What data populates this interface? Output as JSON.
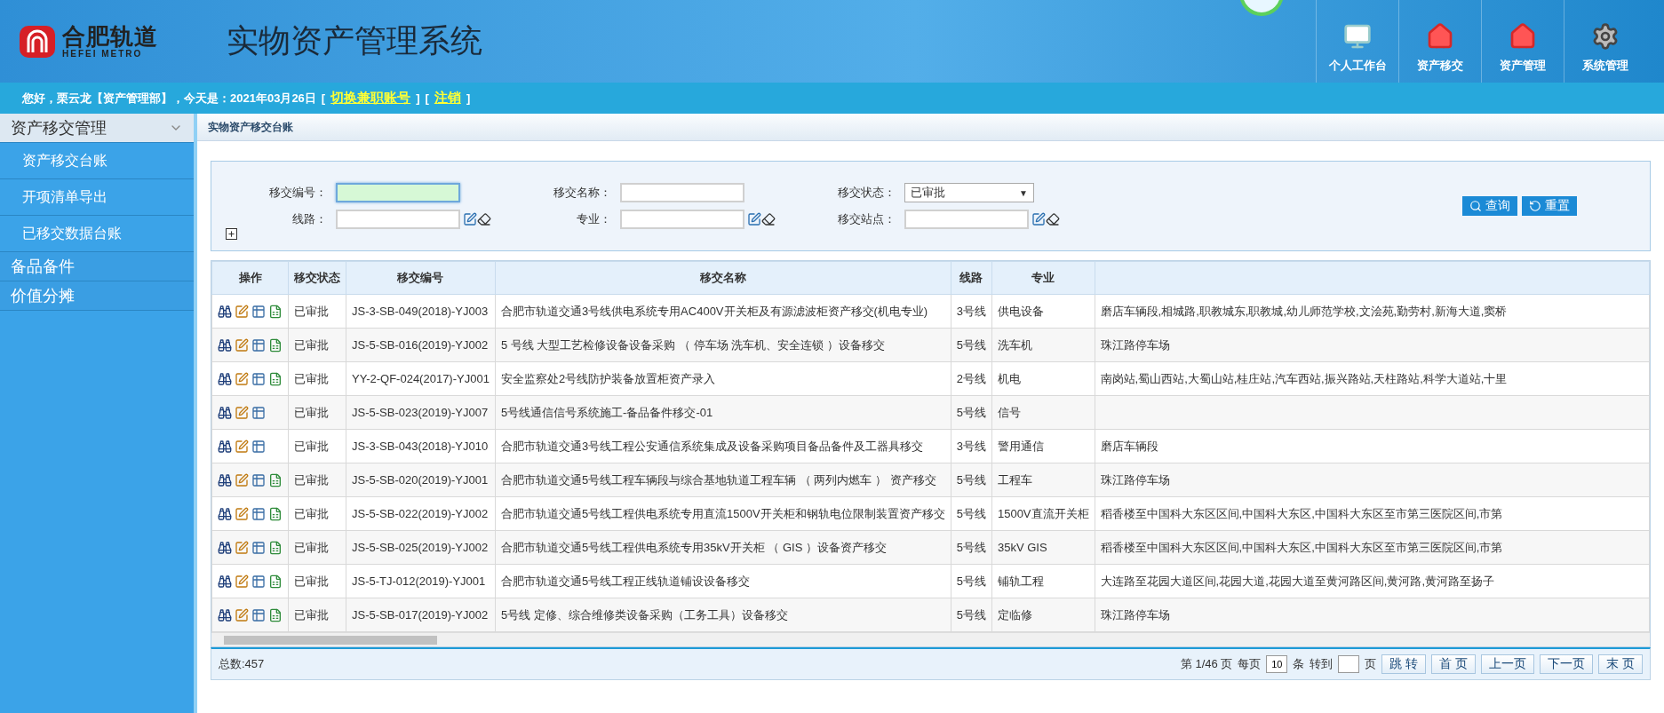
{
  "header": {
    "logo": {
      "name": "合肥轨道",
      "subtitle": "HEFEI METRO"
    },
    "title": "实物资产管理系统",
    "nav": [
      {
        "kind": "monitor",
        "label": "个人工作台"
      },
      {
        "kind": "house",
        "label": "资产移交"
      },
      {
        "kind": "house",
        "label": "资产管理"
      },
      {
        "kind": "gear",
        "label": "系统管理"
      }
    ]
  },
  "welcome": {
    "greeting": "您好，栗云龙【资产管理部】，今天是：2021年03月26日",
    "links": [
      {
        "before": "[",
        "label": "切换兼职账号",
        "after": "]"
      },
      {
        "before": "[",
        "label": "注销",
        "after": "]"
      }
    ]
  },
  "sidebar": {
    "groups": [
      {
        "label": "资产移交管理",
        "expanded": true,
        "items": [
          {
            "label": "资产移交台账",
            "selected": false
          },
          {
            "label": "开项清单导出",
            "selected": false
          },
          {
            "label": "已移交数据台账",
            "selected": false
          }
        ]
      },
      {
        "label": "备品备件",
        "expanded": false
      },
      {
        "label": "价值分摊",
        "expanded": false
      }
    ]
  },
  "breadcrumb": "实物资产移交台账",
  "search": {
    "fields": [
      {
        "kind": "text",
        "label": "移交编号：",
        "focused": true
      },
      {
        "kind": "text",
        "label": "移交名称：",
        "focused": false
      },
      {
        "kind": "select",
        "label": "移交状态：",
        "value": "已审批",
        "caret": "▼"
      },
      {
        "kind": "picker",
        "label": "线路：",
        "focused": false
      },
      {
        "kind": "picker",
        "label": "专业：",
        "focused": false
      },
      {
        "kind": "picker",
        "label": "移交站点："
      }
    ],
    "buttons": [
      {
        "kind": "search",
        "label": "查询"
      },
      {
        "kind": "reset",
        "label": "重置"
      }
    ]
  },
  "table": {
    "columns": [
      "操作",
      "移交状态",
      "移交编号",
      "移交名称",
      "线路",
      "专业"
    ],
    "rows": [
      {
        "exportable": true,
        "status": "已审批",
        "code": "JS-3-SB-049(2018)-YJ003",
        "name": "合肥市轨道交通3号线供电系统专用AC400V开关柜及有源滤波柜资产移交(机电专业)",
        "line": "3号线",
        "major": "供电设备",
        "column_7": "磨店车辆段,相城路,职教城东,职教城,幼儿师范学校,文浍苑,勤劳村,新海大道,窦桥"
      },
      {
        "exportable": true,
        "status": "已审批",
        "code": "JS-5-SB-016(2019)-YJ002",
        "name": "5 号线 大型工艺检修设备设备采购 （ 停车场 洗车机、安全连锁 ）设备移交",
        "line": "5号线",
        "major": "洗车机",
        "column_7": "珠江路停车场"
      },
      {
        "exportable": true,
        "status": "已审批",
        "code": "YY-2-QF-024(2017)-YJ001",
        "name": "安全监察处2号线防护装备放置柜资产录入",
        "line": "2号线",
        "major": "机电",
        "column_7": "南岗站,蜀山西站,大蜀山站,桂庄站,汽车西站,振兴路站,天柱路站,科学大道站,十里"
      },
      {
        "exportable": false,
        "status": "已审批",
        "code": "JS-5-SB-023(2019)-YJ007",
        "name": "5号线通信信号系统施工-备品备件移交-01",
        "line": "5号线",
        "major": "信号"
      },
      {
        "exportable": false,
        "status": "已审批",
        "code": "JS-3-SB-043(2018)-YJ010",
        "name": "合肥市轨道交通3号线工程公安通信系统集成及设备采购项目备品备件及工器具移交",
        "line": "3号线",
        "major": "警用通信",
        "column_7": "磨店车辆段"
      },
      {
        "exportable": true,
        "status": "已审批",
        "code": "JS-5-SB-020(2019)-YJ001",
        "name": "合肥市轨道交通5号线工程车辆段与综合基地轨道工程车辆 （ 两列内燃车 ） 资产移交",
        "line": "5号线",
        "major": "工程车",
        "column_7": "珠江路停车场"
      },
      {
        "exportable": true,
        "status": "已审批",
        "code": "JS-5-SB-022(2019)-YJ002",
        "name": "合肥市轨道交通5号线工程供电系统专用直流1500V开关柜和钢轨电位限制装置资产移交",
        "line": "5号线",
        "major": "1500V直流开关柜",
        "column_7": "稻香楼至中国科大东区区间,中国科大东区,中国科大东区至市第三医院区间,市第"
      },
      {
        "exportable": true,
        "status": "已审批",
        "code": "JS-5-SB-025(2019)-YJ002",
        "name": "合肥市轨道交通5号线工程供电系统专用35kV开关柜 （ GIS ）设备资产移交",
        "line": "5号线",
        "major": "35kV GIS",
        "column_7": "稻香楼至中国科大东区区间,中国科大东区,中国科大东区至市第三医院区间,市第"
      },
      {
        "exportable": true,
        "status": "已审批",
        "code": "JS-5-TJ-012(2019)-YJ001",
        "name": "合肥市轨道交通5号线工程正线轨道铺设设备移交",
        "line": "5号线",
        "major": "铺轨工程",
        "column_7": "大连路至花园大道区间,花园大道,花园大道至黄河路区间,黄河路,黄河路至扬子"
      },
      {
        "exportable": true,
        "status": "已审批",
        "code": "JS-5-SB-017(2019)-YJ002",
        "name": "5号线 定修、综合维修类设备采购（工务工具）设备移交",
        "line": "5号线",
        "major": "定临修",
        "column_7": "珠江路停车场"
      }
    ]
  },
  "footer": {
    "total": "总数:457",
    "page_info": "第 1/46 页",
    "per_page_label": "每页",
    "per_page": "10",
    "per_page_unit": "条",
    "goto_label": "转到",
    "goto_unit": "页",
    "buttons": [
      "跳 转",
      "首 页",
      "上一页",
      "下一页",
      "末 页"
    ]
  }
}
